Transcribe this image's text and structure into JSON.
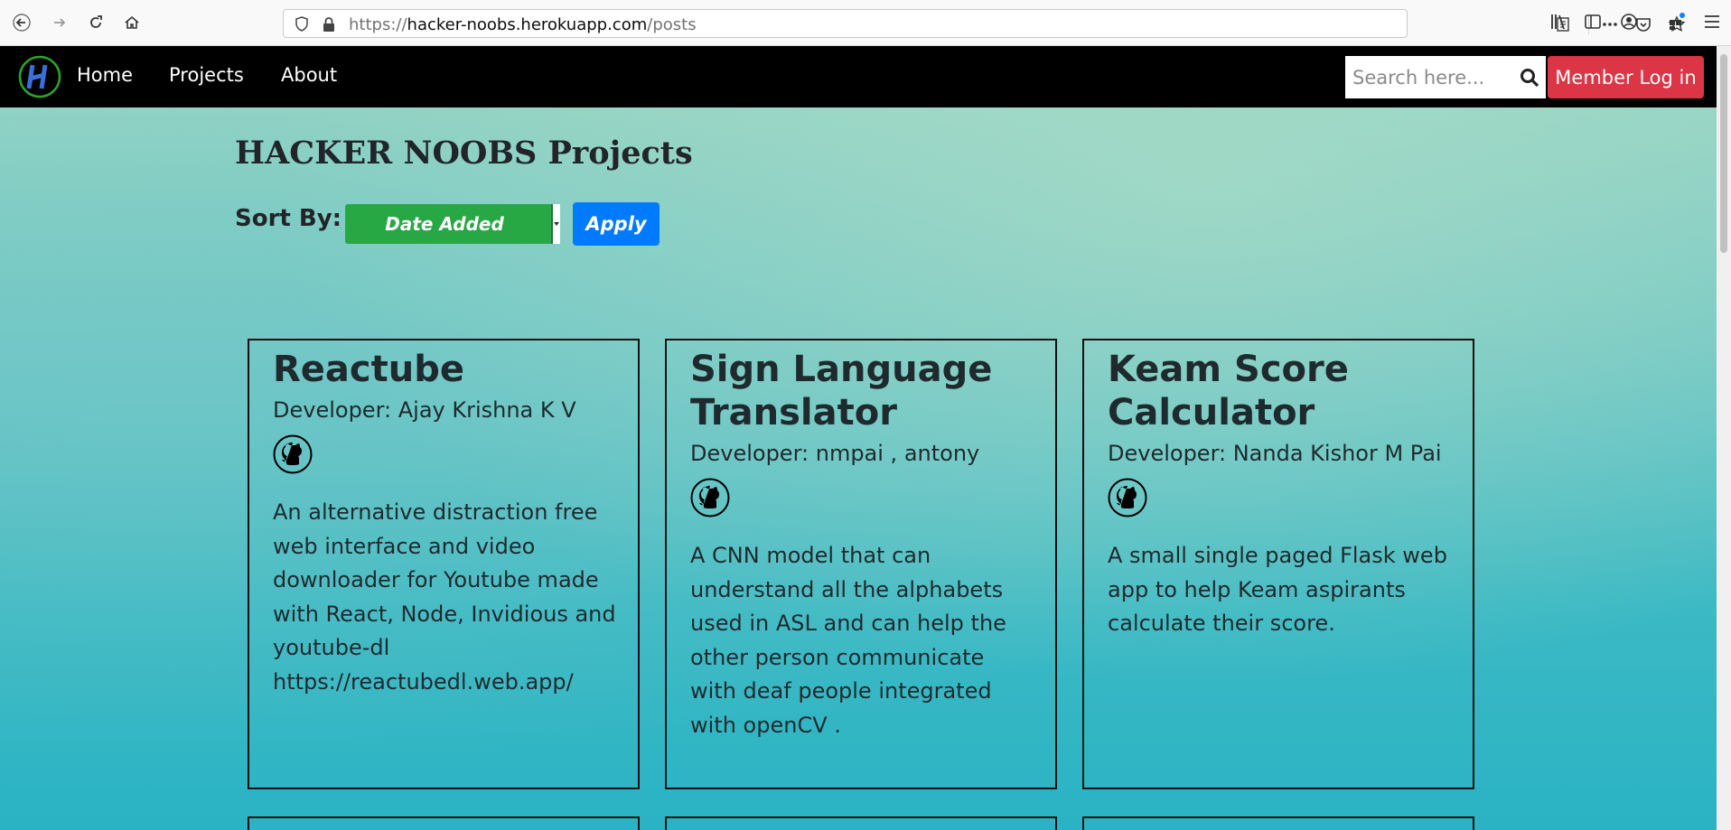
{
  "browser": {
    "url_prefix": "https://",
    "url_host": "hacker-noobs.herokuapp.com",
    "url_path": "/posts"
  },
  "navbar": {
    "links": [
      "Home",
      "Projects",
      "About"
    ],
    "search_placeholder": "Search here...",
    "login_label": "Member Log in"
  },
  "page": {
    "title": "HACKER NOOBS Projects",
    "sort_label": "Sort By:",
    "sort_value": "Date Added",
    "apply_label": "Apply"
  },
  "projects": [
    {
      "title": "Reactube",
      "developer": "Developer: Ajay Krishna K V",
      "description": "An alternative distraction free web interface and video downloader for Youtube made with React, Node, Invidious and youtube-dl https://reactubedl.web.app/"
    },
    {
      "title": "Sign Language Translator",
      "developer": "Developer: nmpai , antony",
      "description": "A CNN model that can understand all the alphabets used in ASL and can help the other person communicate with deaf people integrated with openCV ."
    },
    {
      "title": "Keam Score Calculator",
      "developer": "Developer: Nanda Kishor M Pai",
      "description": "A small single paged Flask web app to help Keam aspirants calculate their score."
    }
  ],
  "colors": {
    "navbar_bg": "#000000",
    "login_bg": "#dc3545",
    "sort_bg": "#28a745",
    "apply_bg": "#007bff"
  }
}
